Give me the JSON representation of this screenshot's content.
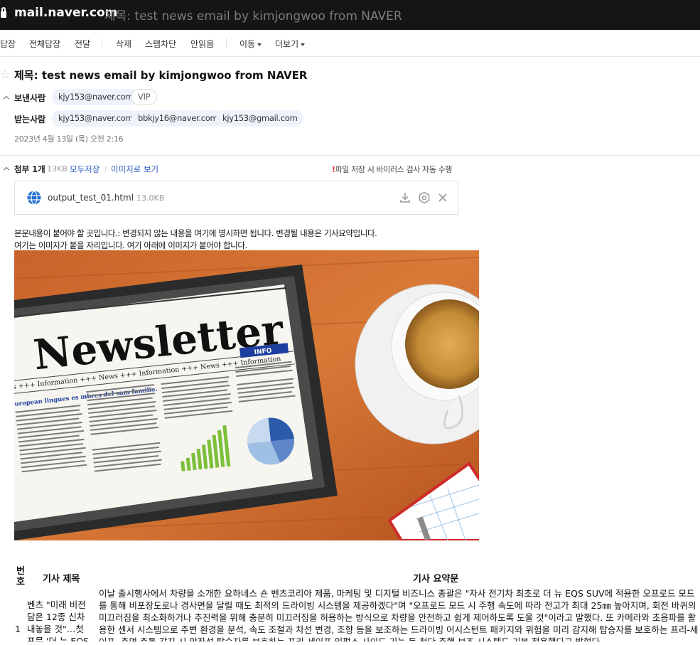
{
  "window": {
    "domain": "mail.naver.com",
    "title": "제목: test news email by kimjongwoo from NAVER"
  },
  "toolbar": {
    "reply": "답장",
    "reply_all": "전체답장",
    "forward": "전달",
    "delete": "삭제",
    "spam_block": "스팸차단",
    "unread": "안읽음",
    "move": "이동",
    "more": "더보기"
  },
  "mail": {
    "subject": "제목: test news email by kimjongwoo from NAVER",
    "sender_label": "보낸사람",
    "sender": "kjy153@naver.com",
    "vip": "VIP",
    "recipient_label": "받는사람",
    "recipients": [
      "kjy153@naver.com",
      "bbkjy16@naver.com",
      "kjy153@gmail.com"
    ],
    "date": "2023년 4월 13일 (목) 오전 2:16"
  },
  "attachments": {
    "label": "첨부 1개",
    "total_size": "13KB",
    "save_all": "모두저장",
    "view_as_image": "이미지로 보기",
    "warning_mark": "!",
    "warning": "파일 저장 시 바이러스 검사 자동 수행",
    "file": {
      "name": "output_test_01.html",
      "size": "13.0KB"
    }
  },
  "body": {
    "line1": "본문내용이 붙어야 할 곳입니다.: 변경되지 않는 내용을 여기에 명시하면 됩니다. 변경될 내용은 기사요약입니다.",
    "line2": "여기는 이미지가 붙을 자리입니다. 여기 아래에 이미지가 붙어야 합니다.",
    "image": {
      "headline": "Newsletter",
      "ticker": "s +++ Information +++ News +++ Information +++ News +++ Information",
      "info_tag": "INFO",
      "col_heading": "uropean lingues es mbres del sam familie."
    }
  },
  "table": {
    "headers": {
      "no": "번호",
      "title": "기사 제목",
      "summary": "기사 요약문"
    },
    "rows": [
      {
        "no": "1",
        "title": "벤츠 \"미래 비전 담은 12종 신차 내놓을 것\"…첫 포문 '더 뉴 EQS",
        "summary": "이날 출시행사에서 차량을 소개한 요하네스 숀 벤츠코리아 제품, 마케팅 및 디지털 비즈니스 총괄은 \"자사 전기차 최초로 더 뉴 EQS SUV에 적용한 오프로드 모드를 통해 비포장도로나 경사면을 달릴 때도 최적의 드라이빙 시스템을 제공하겠다\"며 \"오프로드 모드 시 주행 속도에 따라 전고가 최대 25㎜ 높아지며, 회전 바퀴의 미끄러짐을 최소화하거나 추진력을 위해 충분히 미끄러짐을 허용하는 방식으로 차량을 안전하고 쉽게 제어하도록 도울 것\"이라고 말했다. 또 카메라와 초음파를 활용한 센서 시스템으로 주변 환경을 분석, 속도 조절과 차선 변경, 조향 등을 보조하는 드라이빙 어시스턴트 패키지와 위험을 미리 감지해 탑승자를 보호하는 프리-세이프, 측면 충돌 감지 시 앞좌석 탑승자를 보호하는 프리-세이프 임펄스 사이드 기능 등 첨단 주행 보조 시스템도 기본 적용했다고 밝혔다."
      }
    ]
  }
}
